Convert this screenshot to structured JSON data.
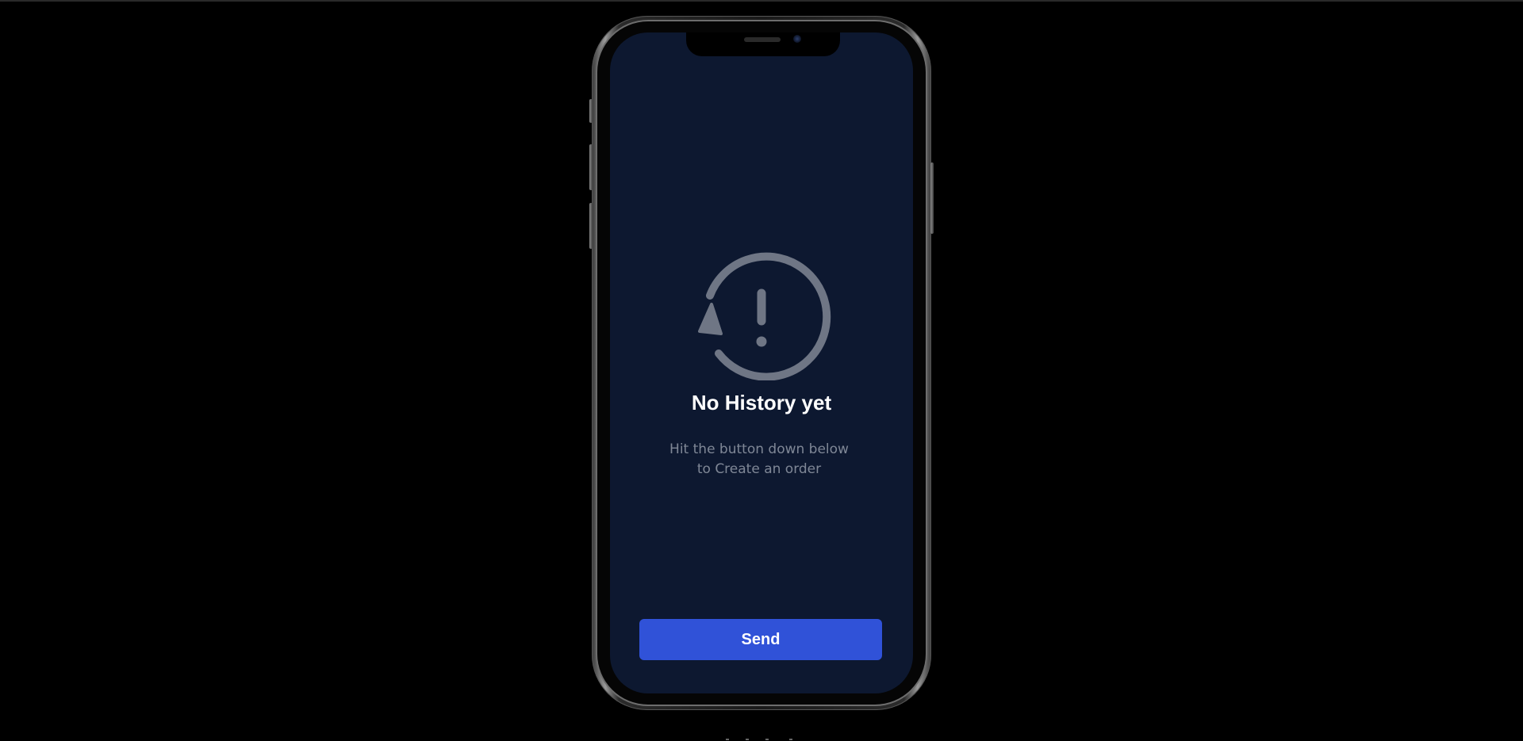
{
  "empty_state": {
    "icon": "history-alert-icon",
    "title": "No History yet",
    "subtitle_line1": "Hit the button down below",
    "subtitle_line2": "to Create an order"
  },
  "actions": {
    "send_label": "Send"
  },
  "colors": {
    "page_background": "#000000",
    "screen_background": "#0d1830",
    "icon_color": "#6f7685",
    "title_color": "#ffffff",
    "subtitle_color": "#7f8796",
    "button_color": "#3052d8"
  }
}
